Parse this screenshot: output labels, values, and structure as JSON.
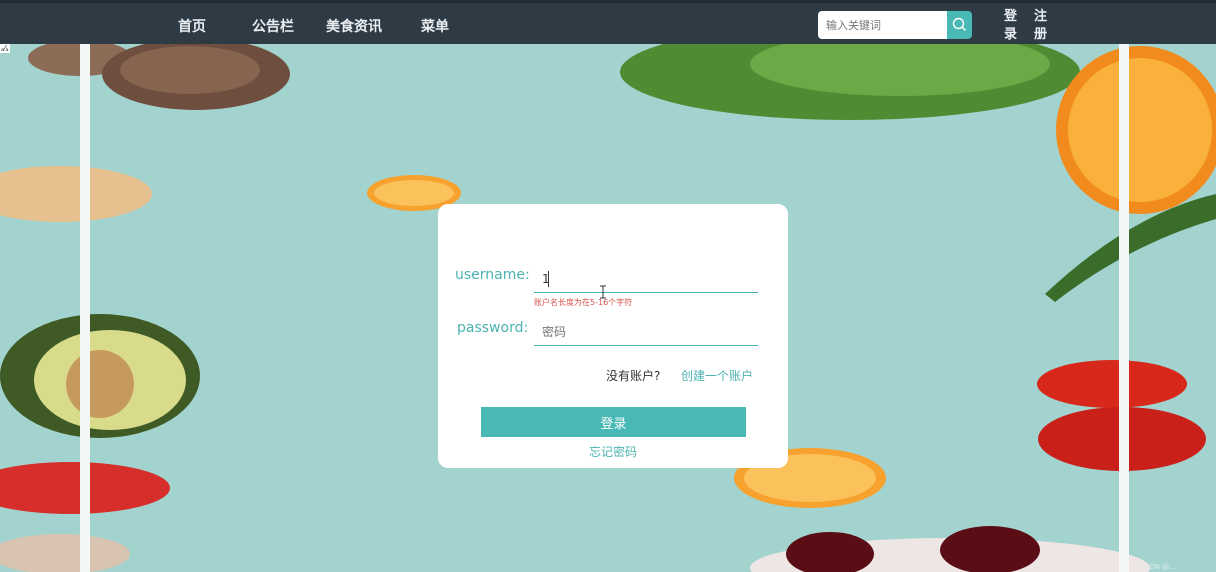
{
  "nav": {
    "items": [
      {
        "label": "首页"
      },
      {
        "label": "公告栏"
      },
      {
        "label": "美食资讯"
      },
      {
        "label": "菜单"
      }
    ],
    "search": {
      "placeholder": "输入关键词",
      "icon": "search-icon"
    },
    "login_label": "登录",
    "register_label": "注册",
    "corner_tag": "ₐ⁄ₐ"
  },
  "login_form": {
    "username_label": "username:",
    "username_value": "1",
    "username_error": "账户名长度为在5-16个字符",
    "password_label": "password:",
    "password_placeholder": "密码",
    "no_account_text": "没有账户?",
    "create_account_link": "创建一个账户",
    "login_button": "登录",
    "forgot_password_link": "忘记密码"
  },
  "footer": {
    "text": "CSDN @..."
  },
  "colors": {
    "nav_bg": "#2e3b45",
    "accent": "#49b9b5",
    "page_bg": "#a2d3ce",
    "error": "#d9534f"
  }
}
